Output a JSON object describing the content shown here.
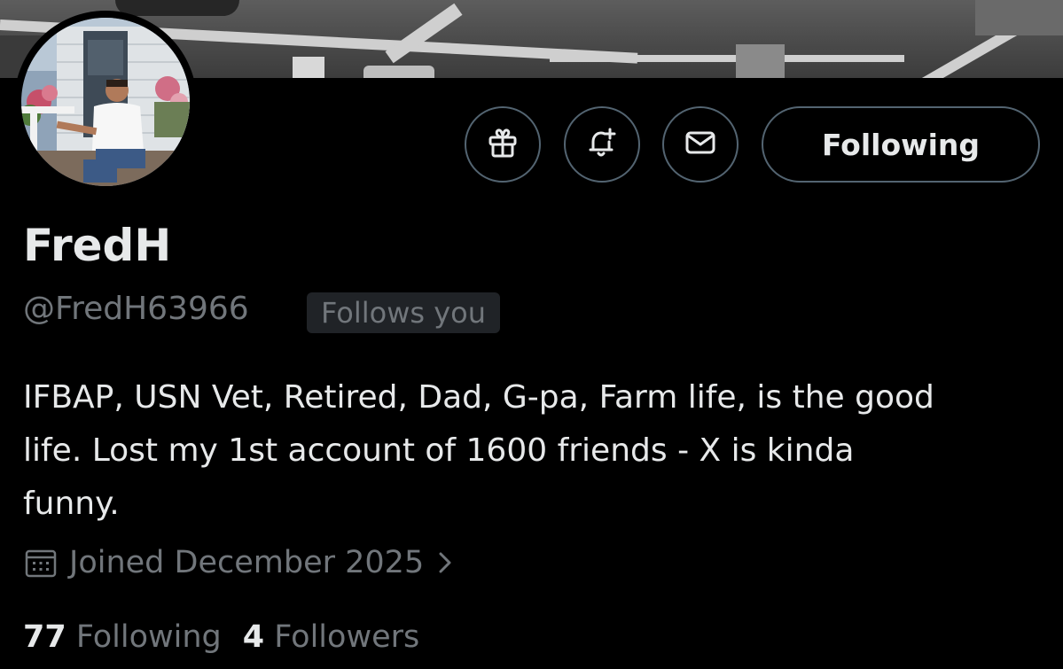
{
  "profile": {
    "display_name": "FredH",
    "handle": "@FredH63966",
    "follows_you_badge": "Follows you",
    "bio_lines": [
      "IFBAP, USN Vet, Retired, Dad, G-pa, Farm life, is the good",
      "life. Lost my 1st account of 1600 friends - X is kinda",
      "funny."
    ],
    "joined": "Joined December 2025",
    "following_count": "77",
    "following_label": "Following",
    "followers_count": "4",
    "followers_label": "Followers"
  },
  "actions": {
    "follow_button_label": "Following",
    "icons": [
      "gift-icon",
      "notification-bell-plus-icon",
      "envelope-icon"
    ]
  },
  "colors": {
    "background": "#000000",
    "primary_text": "#e7e9ea",
    "secondary_text": "#71767b",
    "border": "#536471",
    "badge_bg": "#202327"
  }
}
